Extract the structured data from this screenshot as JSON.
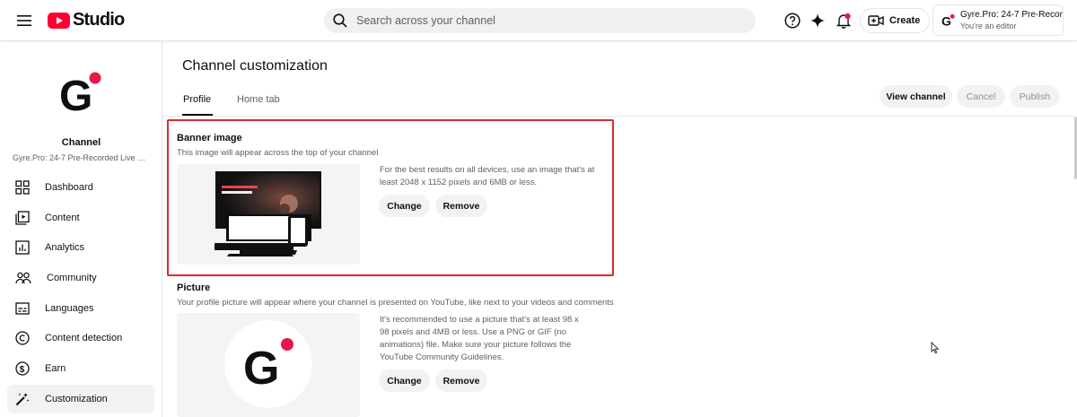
{
  "topbar": {
    "logo_text": "Studio",
    "search_placeholder": "Search across your channel",
    "create_label": "Create",
    "account": {
      "name": "Gyre.Pro: 24-7 Pre-Recor...",
      "role": "You're an editor"
    }
  },
  "sidebar": {
    "channel_label": "Channel",
    "channel_name": "Gyre.Pro: 24-7 Pre-Recorded Live Str...",
    "items": [
      {
        "label": "Dashboard",
        "icon": "dashboard-icon"
      },
      {
        "label": "Content",
        "icon": "content-icon"
      },
      {
        "label": "Analytics",
        "icon": "analytics-icon"
      },
      {
        "label": "Community",
        "icon": "community-icon"
      },
      {
        "label": "Languages",
        "icon": "languages-icon"
      },
      {
        "label": "Content detection",
        "icon": "content-detection-icon"
      },
      {
        "label": "Earn",
        "icon": "earn-icon"
      },
      {
        "label": "Customization",
        "icon": "customization-icon",
        "active": true
      }
    ]
  },
  "main": {
    "title": "Channel customization",
    "tabs": [
      {
        "label": "Profile",
        "active": true
      },
      {
        "label": "Home tab",
        "active": false
      }
    ],
    "actions": {
      "view_channel": "View channel",
      "cancel": "Cancel",
      "publish": "Publish"
    },
    "banner": {
      "title": "Banner image",
      "description": "This image will appear across the top of your channel",
      "info": "For the best results on all devices, use an image that's at least 2048 x 1152 pixels and 6MB or less.",
      "change_label": "Change",
      "remove_label": "Remove"
    },
    "picture": {
      "title": "Picture",
      "description": "Your profile picture will appear where your channel is presented on YouTube, like next to your videos and comments",
      "info": "It's recommended to use a picture that's at least 98 x 98 pixels and 4MB or less. Use a PNG or GIF (no animations) file. Make sure your picture follows the YouTube Community Guidelines.",
      "change_label": "Change",
      "remove_label": "Remove"
    }
  },
  "colors": {
    "youtube_red": "#ff0033",
    "highlight_red": "#d92b30",
    "brand_dot": "#e8174a"
  }
}
